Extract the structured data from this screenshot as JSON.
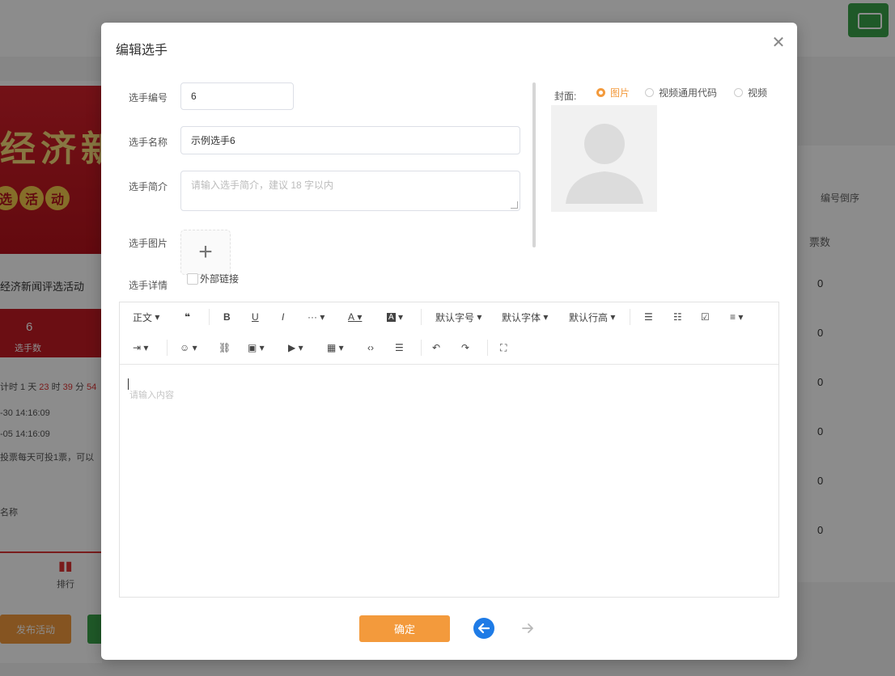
{
  "background": {
    "banner_title": "经济新",
    "banner_pills": [
      "选",
      "活",
      "动"
    ],
    "activity_title": "经济新闻评选活动",
    "stat_value": "6",
    "stat_label": "选手数",
    "countdown_prefix": "计时 1 天 ",
    "countdown_h": "23",
    "countdown_mid1": " 时 ",
    "countdown_m": "39",
    "countdown_mid2": " 分 ",
    "countdown_s": "54",
    "date_start": "-30 14:16:09",
    "date_end": "-05 14:16:09",
    "rule": "投票每天可投1票，可以",
    "name_label": "名称",
    "nav_rank": "排行",
    "publish_btn": "发布活动",
    "sort_label": "编号倒序",
    "votes_header": "票数",
    "vote_values": [
      "0",
      "0",
      "0",
      "0",
      "0",
      "0"
    ]
  },
  "dialog": {
    "title": "编辑选手",
    "close_icon": "close-icon",
    "fields": {
      "number_label": "选手编号",
      "number_value": "6",
      "name_label": "选手名称",
      "name_value": "示例选手6",
      "intro_label": "选手简介",
      "intro_placeholder": "请输入选手简介，建议 18 字以内",
      "image_label": "选手图片",
      "details_label": "选手详情",
      "external_link_label": "外部链接"
    },
    "cover": {
      "label": "封面:",
      "options": [
        "图片",
        "视频通用代码",
        "视频"
      ],
      "selected": "图片"
    },
    "editor": {
      "toolbar_row1": {
        "paragraph": "正文",
        "quote": "❝",
        "bold": "B",
        "underline": "U",
        "italic": "I",
        "more": "···",
        "font_color": "A",
        "bg_color": "A",
        "font_size": "默认字号",
        "font_family": "默认字体",
        "line_height": "默认行高"
      },
      "placeholder": "请输入内容"
    },
    "ok_button": "确定",
    "accent_color": "#f39a3c",
    "nav_color": "#1e7be6"
  }
}
